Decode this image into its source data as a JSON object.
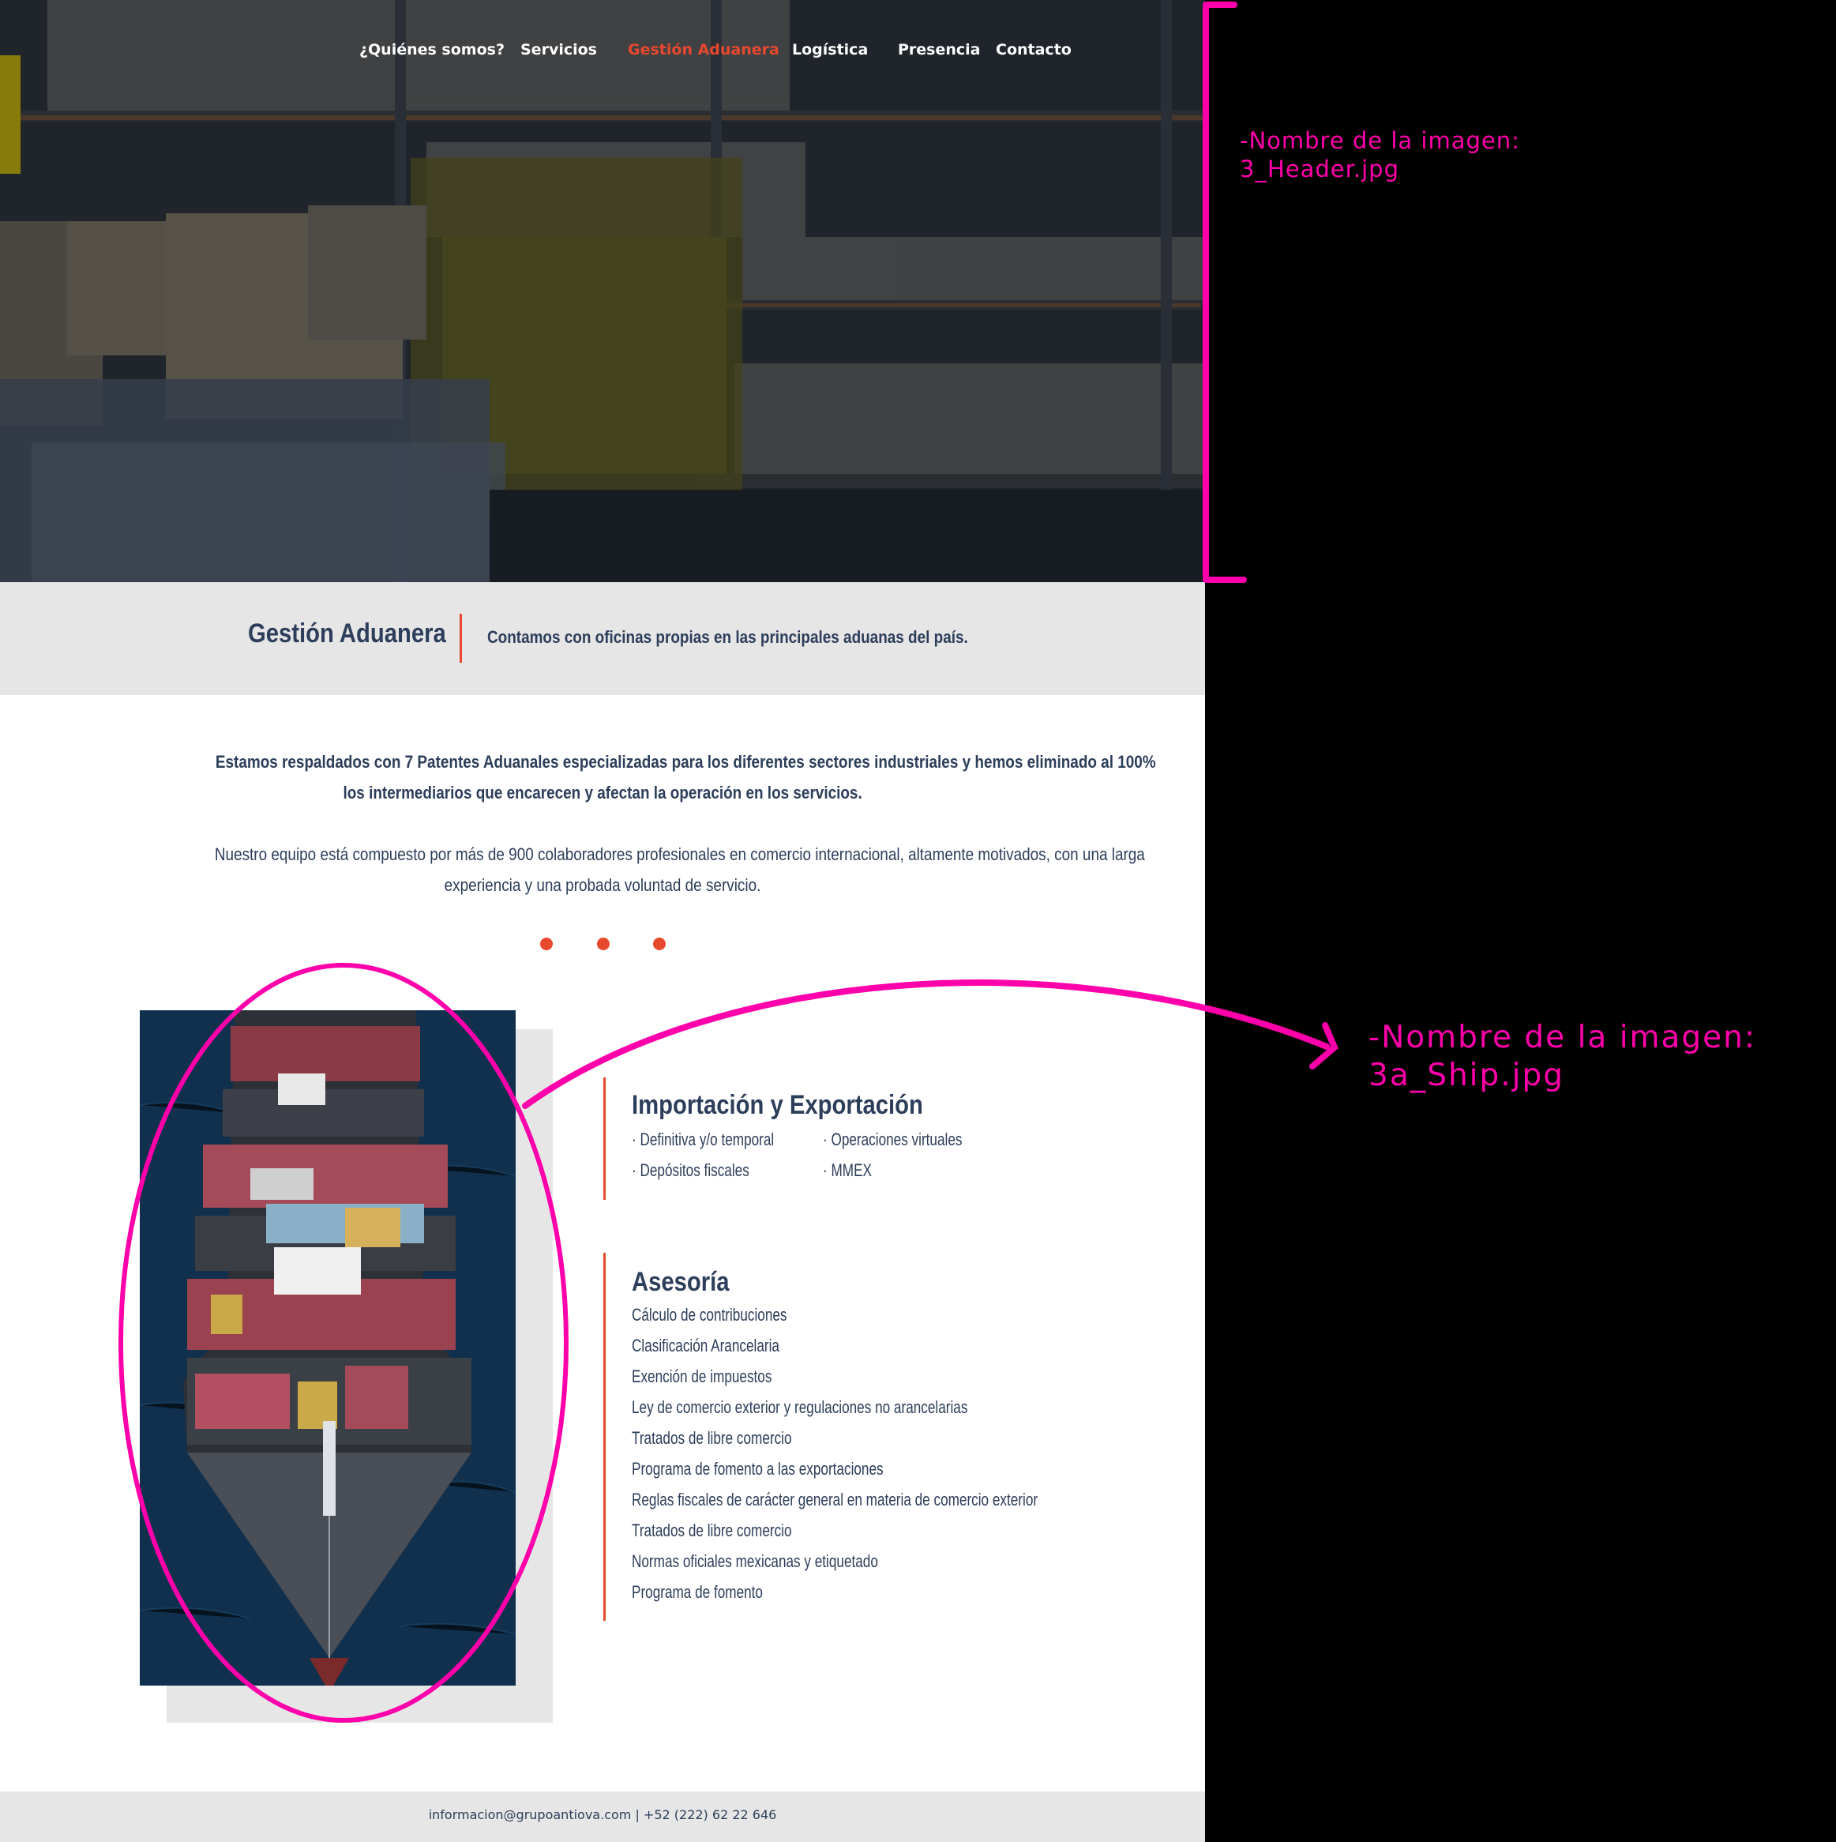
{
  "nav": {
    "items": [
      {
        "label": "¿Quiénes somos?",
        "active": false
      },
      {
        "label": "Servicios",
        "active": false
      },
      {
        "label": "Gestión Aduanera",
        "active": true
      },
      {
        "label": "Logística",
        "active": false
      },
      {
        "label": "Presencia",
        "active": false
      },
      {
        "label": "Contacto",
        "active": false
      }
    ]
  },
  "intro": {
    "title": "Gestión Aduanera",
    "subtitle": "Contamos con oficinas propias en las principales aduanas del país."
  },
  "body": {
    "p1_line1": "Estamos respaldados con 7 Patentes Aduanales especializadas para los diferentes sectores industriales y hemos eliminado al 100%",
    "p1_line2": "los intermediarios que encarecen y afectan la operación en los servicios.",
    "p2_line1": "Nuestro equipo está compuesto por más de 900 colaboradores profesionales en comercio internacional, altamente  motivados, con una larga",
    "p2_line2": "experiencia y una probada voluntad de servicio."
  },
  "services": {
    "import_export": {
      "title": "Importación y Exportación",
      "items": [
        "· Definitiva y/o temporal",
        "· Operaciones virtuales",
        "· Depósitos fiscales",
        "· MMEX"
      ]
    },
    "asesoria": {
      "title": "Asesoría",
      "items": [
        "Cálculo de contribuciones",
        "Clasificación Arancelaria",
        "Exención de impuestos",
        "Ley de comercio exterior y regulaciones no arancelarias",
        "Tratados de libre comercio",
        "Programa de fomento a las exportaciones",
        "Reglas fiscales de carácter general en materia de comercio exterior",
        "Tratados de libre comercio",
        "Normas oficiales mexicanas y etiquetado",
        "Programa de fomento"
      ]
    }
  },
  "footer": {
    "contact": "informacion@grupoantiova.com | +52 (222) 62 22 646"
  },
  "annotations": {
    "header_label": "-Nombre de la imagen:",
    "header_file": "3_Header.jpg",
    "ship_label": "-Nombre de la imagen:",
    "ship_file": "3a_Ship.jpg"
  },
  "colors": {
    "accent": "#e8482e",
    "navy": "#2c3e5a",
    "band": "#e6e6e6",
    "annotation": "#ff00aa"
  }
}
